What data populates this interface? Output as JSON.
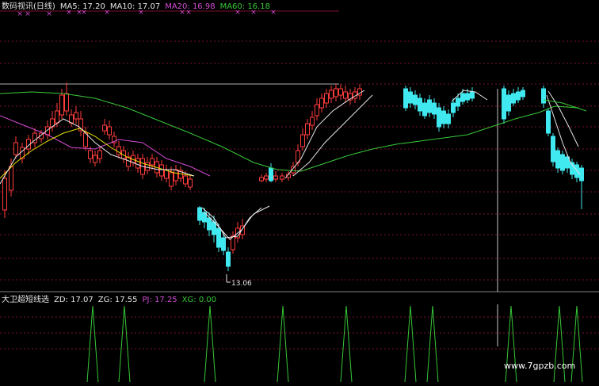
{
  "window": {
    "background": "#000000",
    "grid_color": "#7a1030",
    "separator_color": "#b0b0b0"
  },
  "main_legend": {
    "title": "数码视讯(日线)",
    "ma5": "MA5: 17.20",
    "ma10": "MA10: 17.07",
    "ma20": "MA20: 16.98",
    "ma60": "MA60: 16.18"
  },
  "indicator_legend": {
    "title": "大卫超短线选",
    "zd": "ZD: 17.07",
    "zg": "ZG: 17.55",
    "pj": "PJ: 17.25",
    "xg": "XG: 0.00"
  },
  "annotations": {
    "low_label": "13.06",
    "signal_marker": "×"
  },
  "watermark": "www.7gpzb.com",
  "colors": {
    "up_candle": "#ff3c3c",
    "down_candle": "#40e8f0",
    "ma5": "#e6e6e6",
    "ma10": "#e6e000",
    "ma20": "#d24cd2",
    "ma60": "#37c837",
    "signal": "#37c837",
    "marker": "#d24cd2"
  },
  "chart_data": [
    {
      "type": "candlestick",
      "title": "数码视讯(日线)",
      "series": [
        {
          "name": "MA5",
          "last": 17.2
        },
        {
          "name": "MA10",
          "last": 17.07
        },
        {
          "name": "MA20",
          "last": 16.98
        },
        {
          "name": "MA60",
          "last": 16.18
        }
      ],
      "annotations": [
        {
          "label": "13.06",
          "meaning": "period low"
        }
      ]
    },
    {
      "type": "line",
      "title": "大卫超短线选",
      "series": [
        {
          "name": "ZD",
          "last": 17.07
        },
        {
          "name": "ZG",
          "last": 17.55
        },
        {
          "name": "PJ",
          "last": 17.25
        },
        {
          "name": "XG",
          "last": 0.0
        }
      ]
    }
  ]
}
